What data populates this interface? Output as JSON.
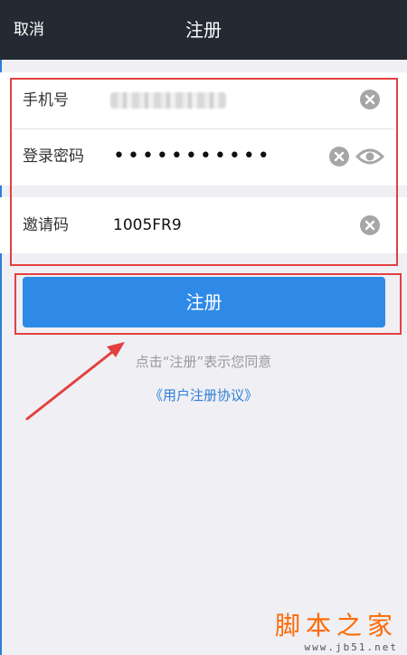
{
  "header": {
    "cancel_label": "取消",
    "title": "注册"
  },
  "form": {
    "phone": {
      "label": "手机号",
      "value_masked": true
    },
    "password": {
      "label": "登录密码",
      "value": "•••••••••••"
    },
    "invite": {
      "label": "邀请码",
      "value": "1005FR9"
    }
  },
  "submit_label": "注册",
  "hint": "点击“注册”表示您同意",
  "agreement_link": "《用户注册协议》",
  "watermark": {
    "main": "脚本之家",
    "url": "www.jb51.net"
  },
  "colors": {
    "header_bg": "#232a33",
    "accent": "#2e8ae6",
    "annotation": "#e34040",
    "link": "#2e7fd6"
  },
  "icons": [
    "clear-icon",
    "eye-icon",
    "annotation-arrow"
  ]
}
